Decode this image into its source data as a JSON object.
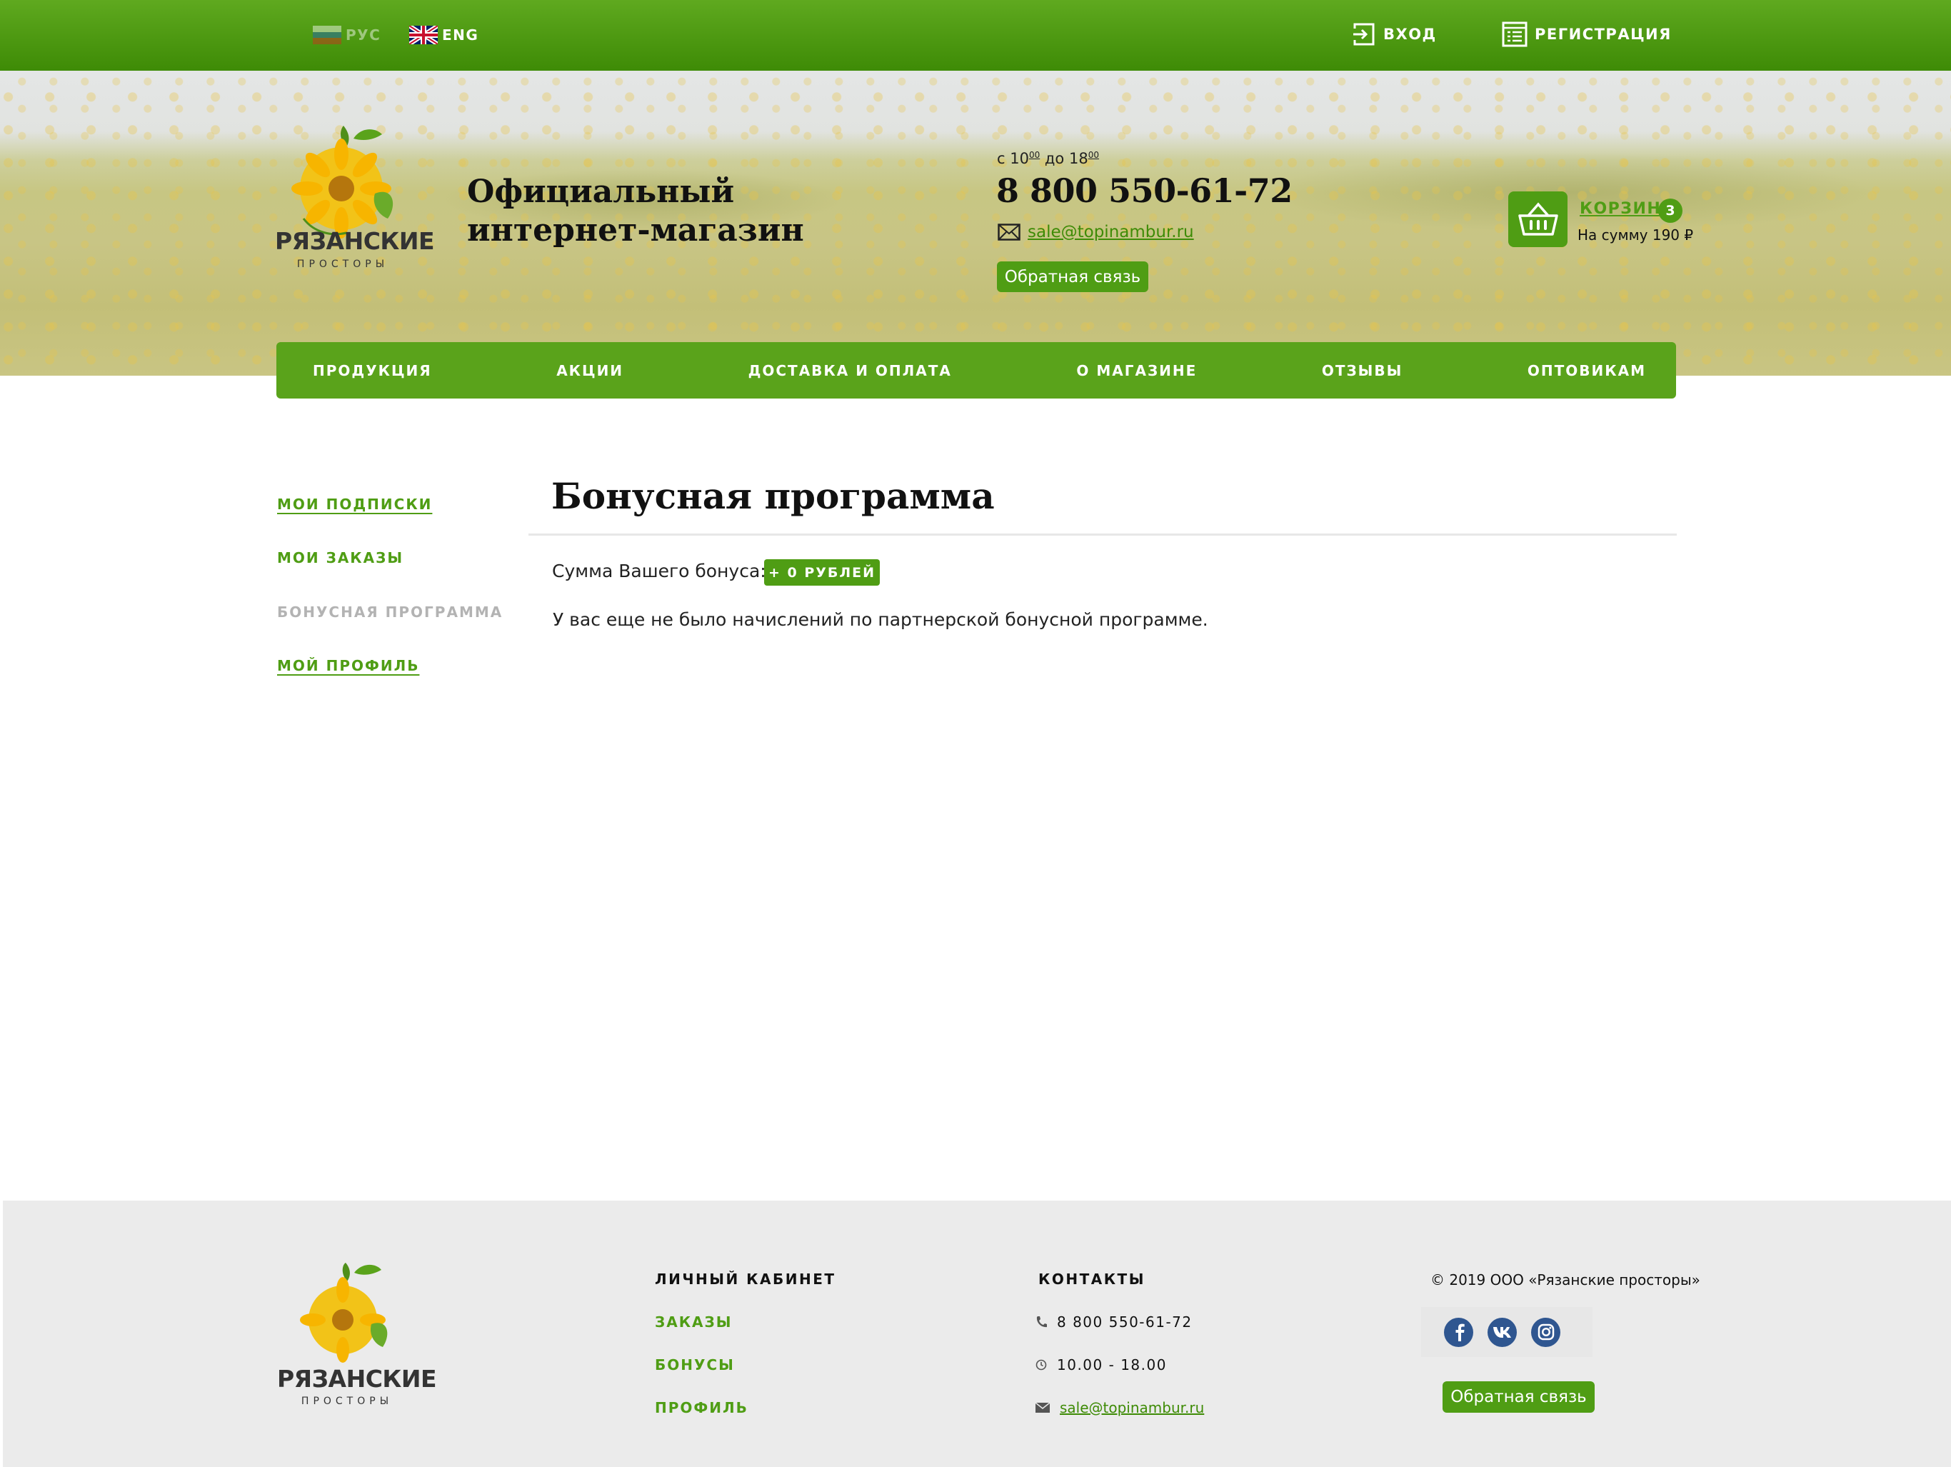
{
  "topbar": {
    "lang_rus": "РУС",
    "lang_eng": "ENG",
    "login": "ВХОД",
    "register": "РЕГИСТРАЦИЯ"
  },
  "header": {
    "logo_title": "РЯЗАНСКИЕ",
    "logo_subtitle": "ПРОСТОРЫ",
    "tagline_line1": "Официальный",
    "tagline_line2": "интернет-магазин",
    "hours_prefix": "с 10",
    "hours_from_min": "00",
    "hours_mid": " до 18",
    "hours_to_min": "00",
    "phone": "8 800 550-61-72",
    "email": "sale@topinambur.ru",
    "feedback": "Обратная связь",
    "cart_label": "КОРЗИНА",
    "cart_count": "3",
    "cart_sum": "На сумму 190 ₽"
  },
  "nav": {
    "items": [
      "ПРОДУКЦИЯ",
      "АКЦИИ",
      "ДОСТАВКА И ОПЛАТА",
      "О МАГАЗИНЕ",
      "ОТЗЫВЫ",
      "ОПТОВИКАМ"
    ]
  },
  "sidebar": {
    "items": [
      "МОИ ПОДПИСКИ",
      "МОИ ЗАКАЗЫ",
      "БОНУСНАЯ ПРОГРАММА",
      "МОЙ ПРОФИЛЬ"
    ],
    "active_index": 2
  },
  "content": {
    "title": "Бонусная программа",
    "bonus_label": "Сумма Вашего бонуса:",
    "bonus_value": "+ 0 РУБЛЕЙ",
    "note": "У вас еще не было начислений по партнерской бонусной программе."
  },
  "footer": {
    "logo_title": "РЯЗАНСКИЕ",
    "logo_subtitle": "ПРОСТОРЫ",
    "cabinet_head": "ЛИЧНЫЙ КАБИНЕТ",
    "cabinet_links": [
      "ЗАКАЗЫ",
      "БОНУСЫ",
      "ПРОФИЛЬ"
    ],
    "contacts_head": "КОНТАКТЫ",
    "phone": "8 800 550-61-72",
    "hours": "10.00 - 18.00",
    "email": "sale@topinambur.ru",
    "copyright": "© 2019 ООО «Рязанские просторы»",
    "social": [
      "facebook-icon",
      "vk-icon",
      "instagram-icon"
    ],
    "feedback": "Обратная связь"
  },
  "colors": {
    "brand_green": "#4f9d14",
    "topbar_green": "#3e8b06",
    "footer_bg": "#ebebeb",
    "social_blue": "#2f5690"
  }
}
